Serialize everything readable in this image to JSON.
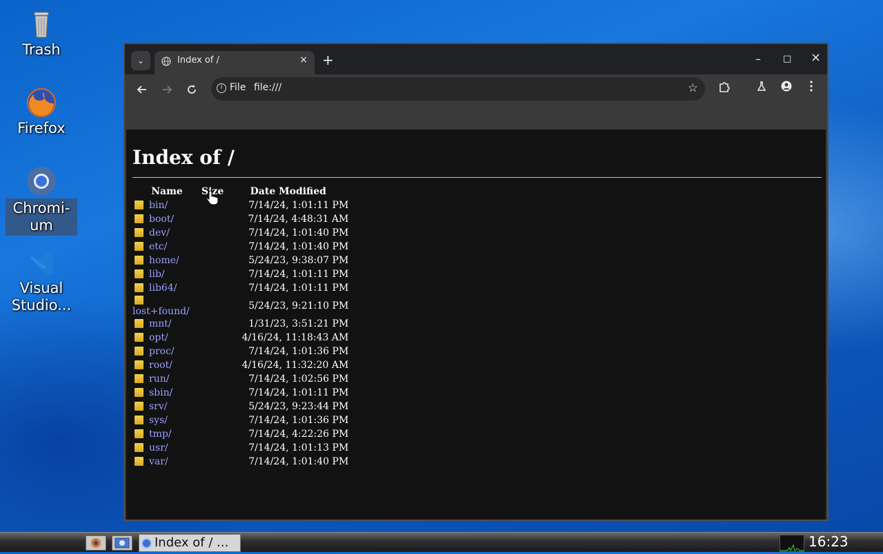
{
  "desktop": {
    "icons": [
      {
        "label": "Trash"
      },
      {
        "label": "Firefox"
      },
      {
        "label": "Chromi-\num"
      },
      {
        "label": "Visual\nStudio..."
      }
    ]
  },
  "browser": {
    "tab": {
      "title": "Index of /",
      "close": "×"
    },
    "new_tab": "+",
    "window_controls": {
      "minimize": "–",
      "maximize": "□",
      "close": "×"
    },
    "omnibox": {
      "scheme": "File",
      "url": "file:///"
    },
    "icons": {
      "back": "back-arrow-icon",
      "forward": "forward-arrow-icon",
      "reload": "reload-icon",
      "bookmark": "star-icon",
      "extensions": "puzzle-icon",
      "labs": "flask-icon",
      "profile": "person-icon",
      "menu": "kebab-menu-icon"
    }
  },
  "page": {
    "heading": "Index of /",
    "columns": {
      "name": "Name",
      "size": "Size",
      "date": "Date Modified"
    },
    "rows": [
      {
        "name": "bin/",
        "size": "",
        "date": "7/14/24, 1:01:11 PM"
      },
      {
        "name": "boot/",
        "size": "",
        "date": "7/14/24, 4:48:31 AM"
      },
      {
        "name": "dev/",
        "size": "",
        "date": "7/14/24, 1:01:40 PM"
      },
      {
        "name": "etc/",
        "size": "",
        "date": "7/14/24, 1:01:40 PM"
      },
      {
        "name": "home/",
        "size": "",
        "date": "5/24/23, 9:38:07 PM"
      },
      {
        "name": "lib/",
        "size": "",
        "date": "7/14/24, 1:01:11 PM"
      },
      {
        "name": "lib64/",
        "size": "",
        "date": "7/14/24, 1:01:11 PM"
      },
      {
        "name": "lost+found/",
        "size": "",
        "date": "5/24/23, 9:21:10 PM"
      },
      {
        "name": "mnt/",
        "size": "",
        "date": "1/31/23, 3:51:21 PM"
      },
      {
        "name": "opt/",
        "size": "",
        "date": "4/16/24, 11:18:43 AM"
      },
      {
        "name": "proc/",
        "size": "",
        "date": "7/14/24, 1:01:36 PM"
      },
      {
        "name": "root/",
        "size": "",
        "date": "4/16/24, 11:32:20 AM"
      },
      {
        "name": "run/",
        "size": "",
        "date": "7/14/24, 1:02:56 PM"
      },
      {
        "name": "sbin/",
        "size": "",
        "date": "7/14/24, 1:01:11 PM"
      },
      {
        "name": "srv/",
        "size": "",
        "date": "5/24/23, 9:23:44 PM"
      },
      {
        "name": "sys/",
        "size": "",
        "date": "7/14/24, 1:01:36 PM"
      },
      {
        "name": "tmp/",
        "size": "",
        "date": "7/14/24, 4:22:26 PM"
      },
      {
        "name": "usr/",
        "size": "",
        "date": "7/14/24, 1:01:13 PM"
      },
      {
        "name": "var/",
        "size": "",
        "date": "7/14/24, 1:01:40 PM"
      }
    ]
  },
  "taskbar": {
    "task_title": "Index of / ...",
    "clock": "16:23"
  },
  "colors": {
    "link": "#9aa0ff",
    "page_bg": "#121212",
    "toolbar_bg": "#3a3a3a",
    "tabstrip_bg": "#202124"
  }
}
